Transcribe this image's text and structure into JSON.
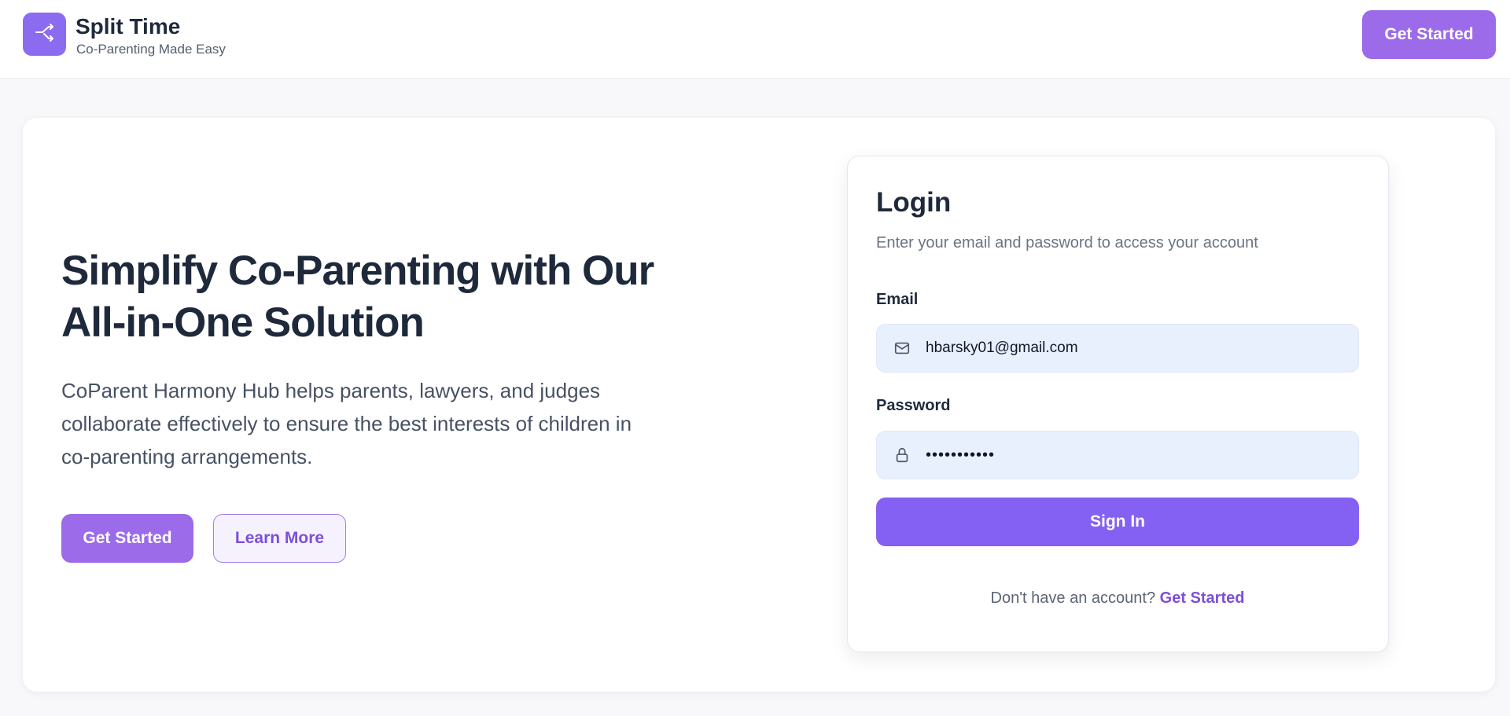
{
  "header": {
    "brand_title": "Split Time",
    "brand_subtitle": "Co-Parenting Made Easy",
    "get_started_label": "Get Started",
    "logo_icon": "split-arrows-icon"
  },
  "hero": {
    "title_line1": "Simplify Co-Parenting with Our",
    "title_line2": "All-in-One Solution",
    "description_line1": "CoParent Harmony Hub helps parents, lawyers, and judges",
    "description_line2": "collaborate effectively to ensure the best interests of children in",
    "description_line3": "co-parenting arrangements.",
    "primary_button": "Get Started",
    "secondary_button": "Learn More"
  },
  "login": {
    "title": "Login",
    "subtitle": "Enter your email and password to access your account",
    "email_label": "Email",
    "email_value": "hbarsky01@gmail.com",
    "email_icon": "mail-icon",
    "password_label": "Password",
    "password_value": "•••••••••••",
    "password_icon": "lock-icon",
    "sign_in_label": "Sign In",
    "signup_prompt": "Don't have an account?",
    "signup_link": "Get Started"
  },
  "colors": {
    "accent": "#9b6bea",
    "sign_in_button": "#8461f2",
    "input_background": "#e8f0fe",
    "link": "#7c4fd9"
  }
}
